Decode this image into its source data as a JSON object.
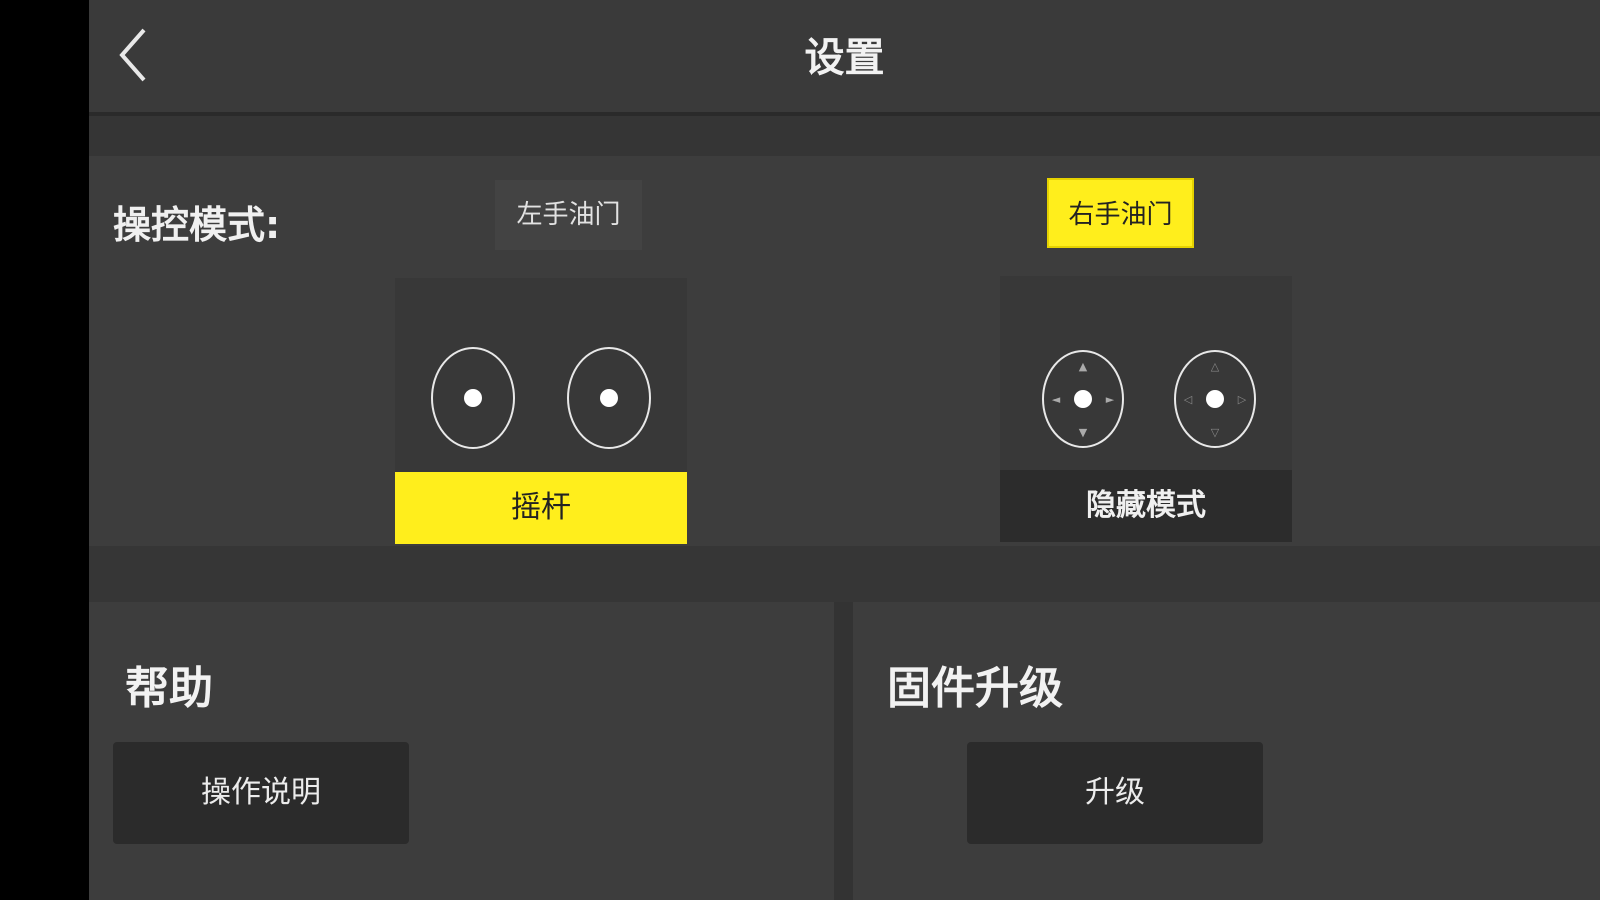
{
  "header": {
    "title": "设置",
    "back_icon": "chevron-left-icon"
  },
  "control_mode": {
    "label": "操控模式:",
    "left_option": "左手油门",
    "right_option": "右手油门",
    "selected": "右手油门",
    "cards": [
      {
        "label": "摇杆",
        "selected": true,
        "icon": "joystick-icon"
      },
      {
        "label": "隐藏模式",
        "selected": false,
        "icon": "hidden-joystick-icon"
      }
    ]
  },
  "help": {
    "title": "帮助",
    "button": "操作说明"
  },
  "firmware": {
    "title": "固件升级",
    "button": "升级"
  },
  "colors": {
    "accent": "#ffee1c",
    "background": "#3c3c3c",
    "button_dark": "#2b2b2b"
  }
}
